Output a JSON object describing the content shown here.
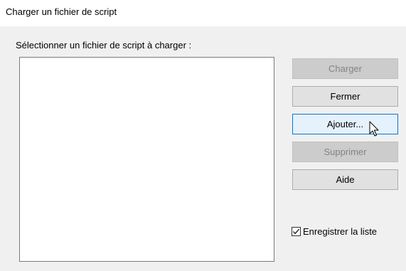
{
  "window": {
    "title": "Charger un fichier de script"
  },
  "dialog": {
    "instruction": "Sélectionner un fichier de script à charger :",
    "file_list": {
      "items": []
    },
    "buttons": {
      "load": {
        "label": "Charger",
        "state": "disabled"
      },
      "close": {
        "label": "Fermer",
        "state": "enabled"
      },
      "add": {
        "label": "Ajouter...",
        "state": "hover"
      },
      "remove": {
        "label": "Supprimer",
        "state": "disabled"
      },
      "help": {
        "label": "Aide",
        "state": "enabled"
      }
    },
    "save_list": {
      "label": "Enregistrer la liste",
      "checked": true
    }
  },
  "colors": {
    "accent": "#0078d7",
    "dialog_background": "#f0f0f0"
  }
}
